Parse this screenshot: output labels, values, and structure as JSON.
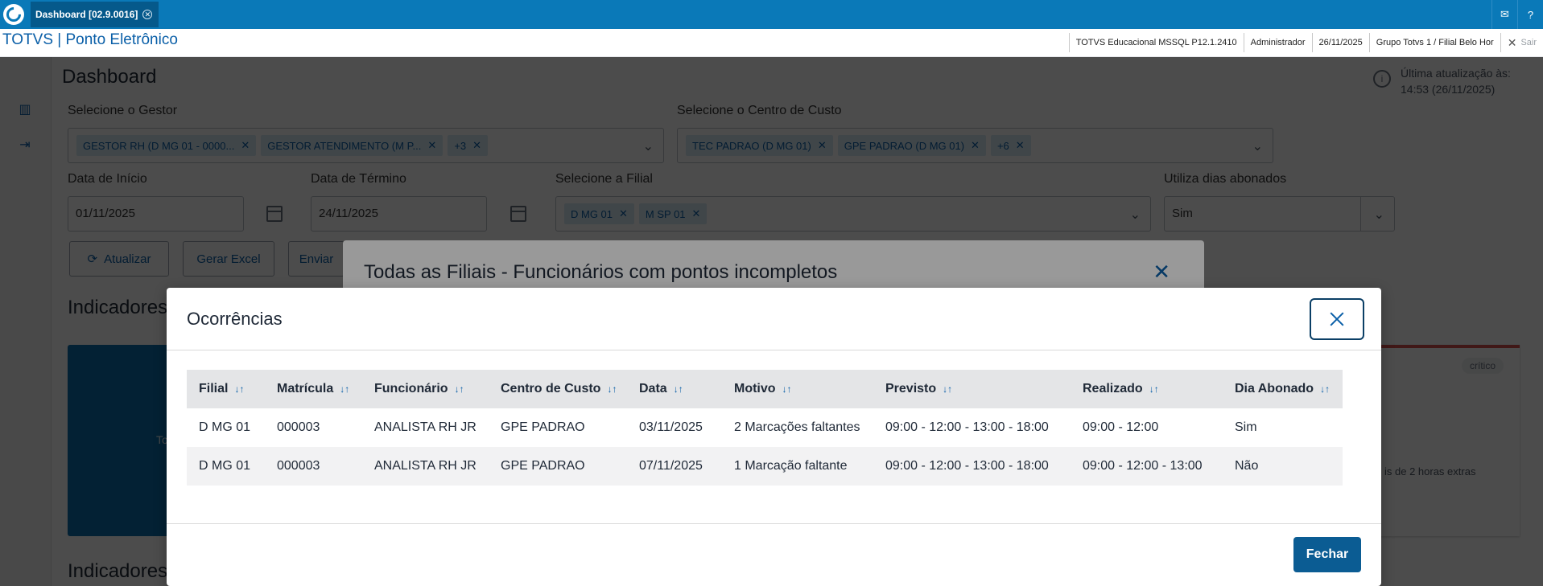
{
  "window": {
    "tab_label": "Dashboard [02.9.0016]",
    "close_glyph": "✕"
  },
  "topbar_icons": [
    "mail-icon",
    "help-icon"
  ],
  "header": {
    "app_title": "TOTVS | Ponto Eletrônico",
    "environment": "TOTVS Educacional MSSQL P12.1.2410",
    "user": "Administrador",
    "date": "26/11/2025",
    "branch": "Grupo Totvs 1 / Filial Belo Hor",
    "exit_label": "Sair"
  },
  "dashboard": {
    "title": "Dashboard",
    "last_update_line1": "Última atualização às:",
    "last_update_line2": "14:53 (26/11/2025)",
    "gestor": {
      "label": "Selecione o Gestor",
      "chips": [
        "GESTOR RH (D MG 01 - 0000...",
        "GESTOR ATENDIMENTO (M P...",
        "+3"
      ]
    },
    "centro_custo": {
      "label": "Selecione o Centro de Custo",
      "chips": [
        "TEC PADRAO (D MG 01)",
        "GPE PADRAO (D MG 01)",
        "+6"
      ]
    },
    "data_inicio": {
      "label": "Data de Início",
      "value": "01/11/2025"
    },
    "data_termino": {
      "label": "Data de Término",
      "value": "24/11/2025"
    },
    "filial": {
      "label": "Selecione a Filial",
      "chips": [
        "D MG 01",
        "M SP 01"
      ]
    },
    "dias_abonados": {
      "label": "Utiliza dias abonados",
      "value": "Sim"
    },
    "buttons": {
      "atualizar": "Atualizar",
      "gerar_excel": "Gerar Excel",
      "enviar": "Enviar"
    },
    "section1_title": "Indicadores",
    "section2_title": "Indicadores",
    "card_left_text": "To",
    "card_right_tag": "crítico",
    "card_right_desc": "is de 2 horas extras"
  },
  "modal_back": {
    "title": "Todas as Filiais - Funcionários com pontos incompletos"
  },
  "modal": {
    "title": "Ocorrências",
    "columns": [
      "Filial",
      "Matrícula",
      "Funcionário",
      "Centro de Custo",
      "Data",
      "Motivo",
      "Previsto",
      "Realizado",
      "Dia Abonado"
    ],
    "sort_glyph": "↓↑",
    "rows": [
      [
        "D MG 01",
        "000003",
        "ANALISTA RH JR",
        "GPE PADRAO",
        "03/11/2025",
        "2 Marcações faltantes",
        "09:00 - 12:00 - 13:00 - 18:00",
        "09:00 - 12:00",
        "Sim"
      ],
      [
        "D MG 01",
        "000003",
        "ANALISTA RH JR",
        "GPE PADRAO",
        "07/11/2025",
        "1 Marcação faltante",
        "09:00 - 12:00 - 13:00 - 18:00",
        "09:00 - 12:00 - 13:00",
        "Não"
      ]
    ],
    "close_button": "Fechar"
  }
}
